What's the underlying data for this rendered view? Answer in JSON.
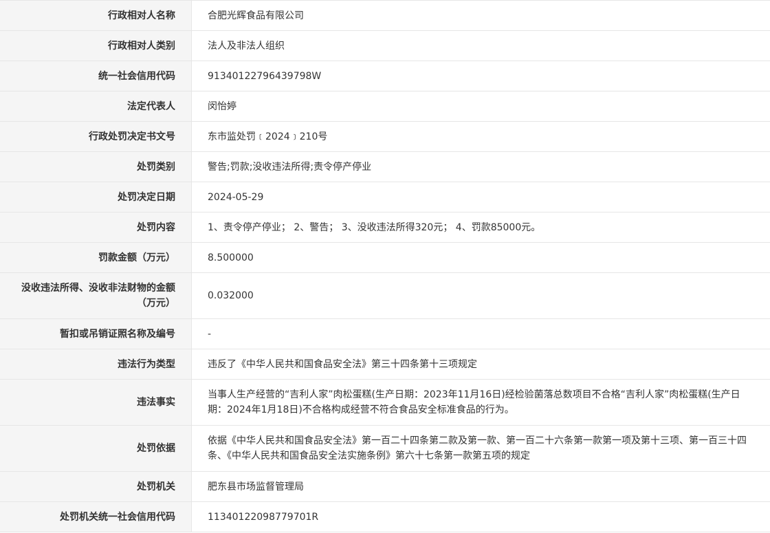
{
  "rows": [
    {
      "label": "行政相对人名称",
      "value": "合肥光辉食品有限公司"
    },
    {
      "label": "行政相对人类别",
      "value": "法人及非法人组织"
    },
    {
      "label": "统一社会信用代码",
      "value": "91340122796439798W"
    },
    {
      "label": "法定代表人",
      "value": "闵怡婷"
    },
    {
      "label": "行政处罚决定书文号",
      "value": "东市监处罚﹝2024﹞210号"
    },
    {
      "label": "处罚类别",
      "value": "警告;罚款;没收违法所得;责令停产停业"
    },
    {
      "label": "处罚决定日期",
      "value": "2024-05-29"
    },
    {
      "label": "处罚内容",
      "value": "1、责令停产停业； 2、警告； 3、没收违法所得320元； 4、罚款85000元。"
    },
    {
      "label": "罚款金额（万元）",
      "value": "8.500000"
    },
    {
      "label": "没收违法所得、没收非法财物的金额（万元）",
      "value": "0.032000"
    },
    {
      "label": "暂扣或吊销证照名称及编号",
      "value": "-"
    },
    {
      "label": "违法行为类型",
      "value": "违反了《中华人民共和国食品安全法》第三十四条第十三项规定"
    },
    {
      "label": "违法事实",
      "value": "当事人生产经营的“吉利人家”肉松蛋糕(生产日期：2023年11月16日)经检验菌落总数项目不合格“吉利人家”肉松蛋糕(生产日期：2024年1月18日)不合格构成经营不符合食品安全标准食品的行为。"
    },
    {
      "label": "处罚依据",
      "value": "依据《中华人民共和国食品安全法》第一百二十四条第二款及第一款、第一百二十六条第一款第一项及第十三项、第一百三十四条、《中华人民共和国食品安全法实施条例》第六十七条第一款第五项的规定"
    },
    {
      "label": "处罚机关",
      "value": "肥东县市场监督管理局"
    },
    {
      "label": "处罚机关统一社会信用代码",
      "value": "11340122098779701R"
    }
  ]
}
